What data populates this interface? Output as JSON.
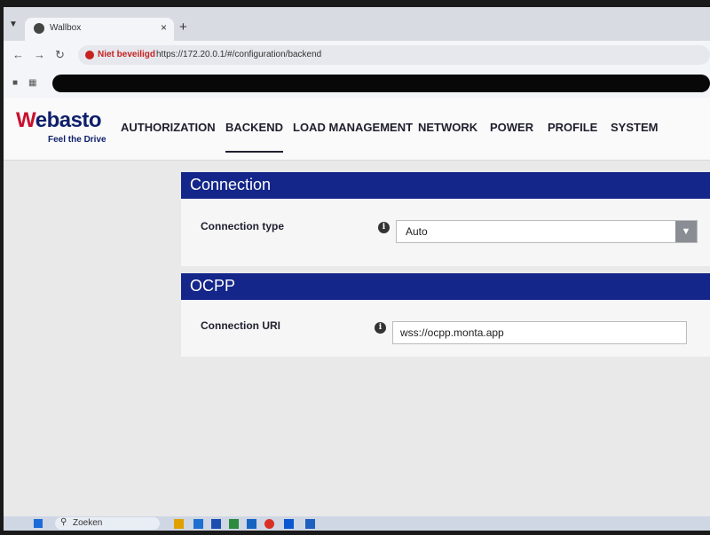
{
  "browser": {
    "tab_title": "Wallbox",
    "tab_close": "×",
    "new_tab": "+",
    "security_label": "Niet beveiligd",
    "url": "https://172.20.0.1/#/configuration/backend"
  },
  "brand": {
    "logo_first": "W",
    "logo_rest": "ebasto",
    "tagline": "Feel the Drive",
    "primary_color": "#14268a",
    "accent_color": "#c8102e"
  },
  "nav": {
    "items": [
      {
        "label": "AUTHORIZATION",
        "active": false
      },
      {
        "label": "BACKEND",
        "active": true
      },
      {
        "label": "LOAD MANAGEMENT",
        "active": false
      },
      {
        "label": "NETWORK",
        "active": false
      },
      {
        "label": "POWER",
        "active": false
      },
      {
        "label": "PROFILE",
        "active": false
      },
      {
        "label": "SYSTEM",
        "active": false
      }
    ]
  },
  "connection": {
    "title": "Connection",
    "type_label": "Connection type",
    "type_value": "Auto",
    "info_glyph": "i"
  },
  "ocpp": {
    "title": "OCPP",
    "uri_label": "Connection URI",
    "uri_value": "wss://ocpp.monta.app",
    "info_glyph": "i"
  },
  "taskbar": {
    "search_label": "Zoeken"
  }
}
